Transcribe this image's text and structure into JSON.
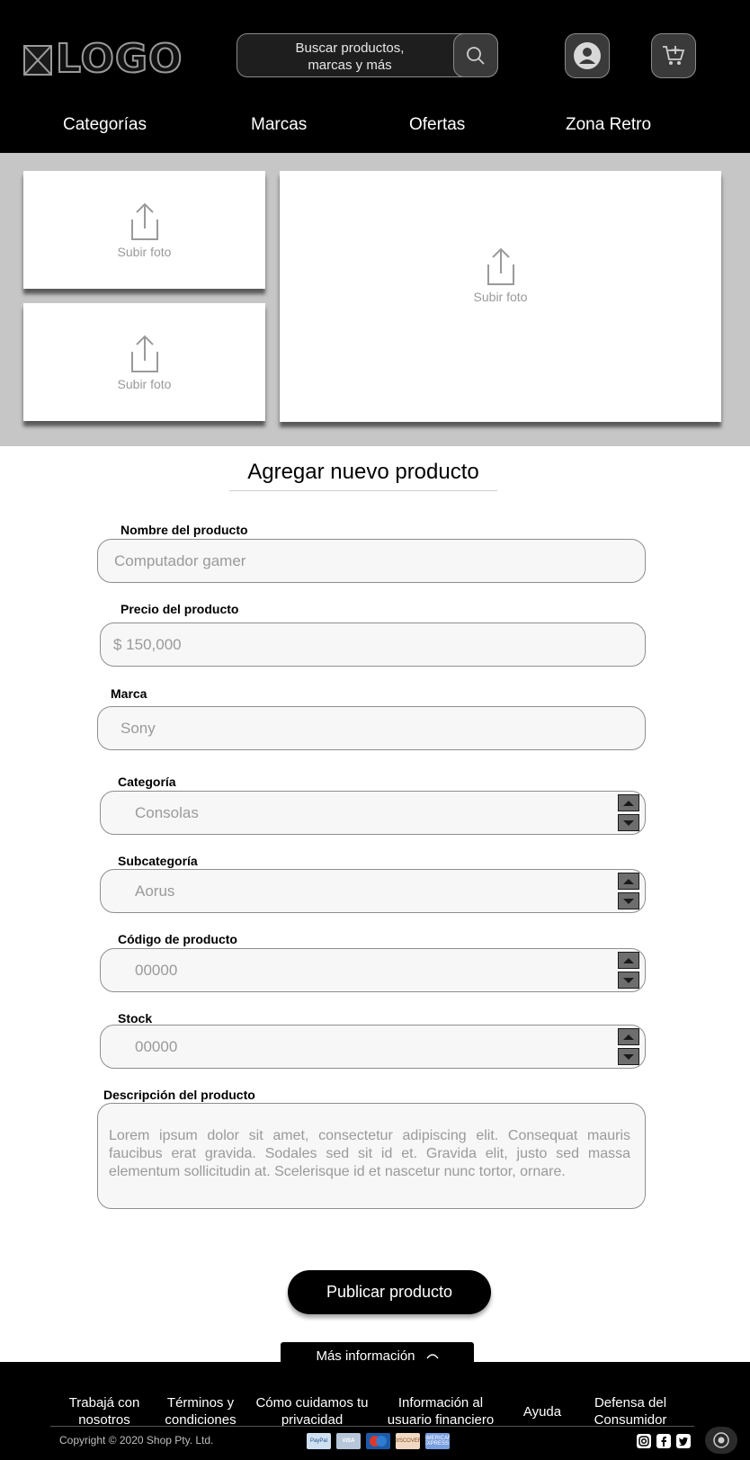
{
  "header": {
    "logo_text": "LOGO",
    "search": {
      "placeholder": "Buscar productos, marcas y más"
    },
    "nav": [
      {
        "label": "Categorías"
      },
      {
        "label": "Marcas"
      },
      {
        "label": "Ofertas"
      },
      {
        "label": "Zona Retro"
      }
    ]
  },
  "photos": {
    "upload_label": "Subir foto"
  },
  "form": {
    "title": "Agregar nuevo producto",
    "fields": {
      "name": {
        "label": "Nombre del producto",
        "placeholder": "Computador gamer"
      },
      "price": {
        "label": "Precio del producto",
        "placeholder": "$ 150,000"
      },
      "brand": {
        "label": "Marca",
        "placeholder": "Sony"
      },
      "category": {
        "label": "Categoría",
        "placeholder": "Consolas"
      },
      "subcategory": {
        "label": "Subcategoría",
        "placeholder": "Aorus"
      },
      "code": {
        "label": "Código de producto",
        "placeholder": "00000"
      },
      "stock": {
        "label": "Stock",
        "placeholder": "00000"
      },
      "description": {
        "label": "Descripción del producto",
        "placeholder": "Lorem ipsum dolor sit amet, consectetur adipiscing elit. Consequat mauris faucibus erat gravida. Sodales sed sit id et. Gravida elit, justo sed massa elementum sollicitudin at. Scelerisque id et nascetur nunc tortor, ornare."
      }
    },
    "publish_label": "Publicar producto"
  },
  "footer": {
    "more_info": "Más información",
    "links": [
      {
        "label": "Trabajá con nosotros"
      },
      {
        "label": "Términos y condiciones"
      },
      {
        "label": "Cómo cuidamos tu privacidad"
      },
      {
        "label": "Información al usuario financiero"
      },
      {
        "label": "Ayuda"
      },
      {
        "label": "Defensa del Consumidor"
      }
    ],
    "copyright": "Copyright © 2020 Shop Pty. Ltd.",
    "payments": [
      "PayPal",
      "VISA",
      "maestro",
      "DISCOVER",
      "AMERICAN EXPRESS"
    ],
    "social_icons": [
      "instagram-icon",
      "facebook-icon",
      "twitter-icon"
    ]
  }
}
